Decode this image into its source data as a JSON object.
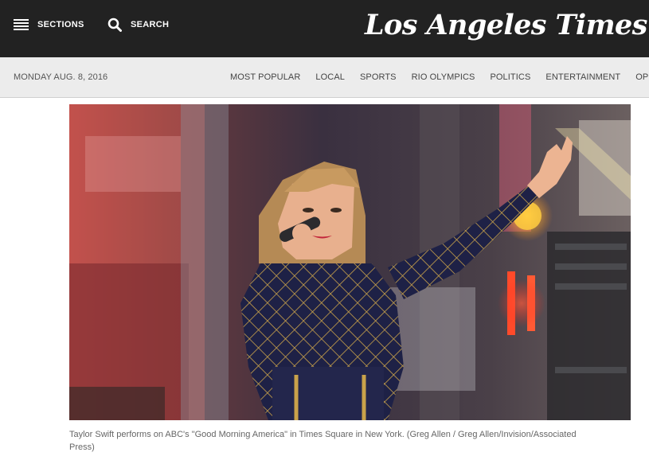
{
  "topbar": {
    "sections_label": "SECTIONS",
    "search_label": "SEARCH",
    "logo_text": "Los Angeles Times"
  },
  "subnav": {
    "date": "MONDAY AUG. 8, 2016",
    "links": [
      {
        "label": "MOST POPULAR"
      },
      {
        "label": "LOCAL"
      },
      {
        "label": "SPORTS"
      },
      {
        "label": "RIO OLYMPICS"
      },
      {
        "label": "POLITICS"
      },
      {
        "label": "ENTERTAINMENT"
      },
      {
        "label": "OPINION"
      }
    ]
  },
  "article": {
    "caption": "Taylor Swift performs on ABC's \"Good Morning America\" in Times Square in New York. (Greg Allen / Greg Allen/Invision/Associated Press)"
  },
  "colors": {
    "topbar_bg": "#222222",
    "subnav_bg": "#ececec",
    "caption_text": "#666666"
  }
}
